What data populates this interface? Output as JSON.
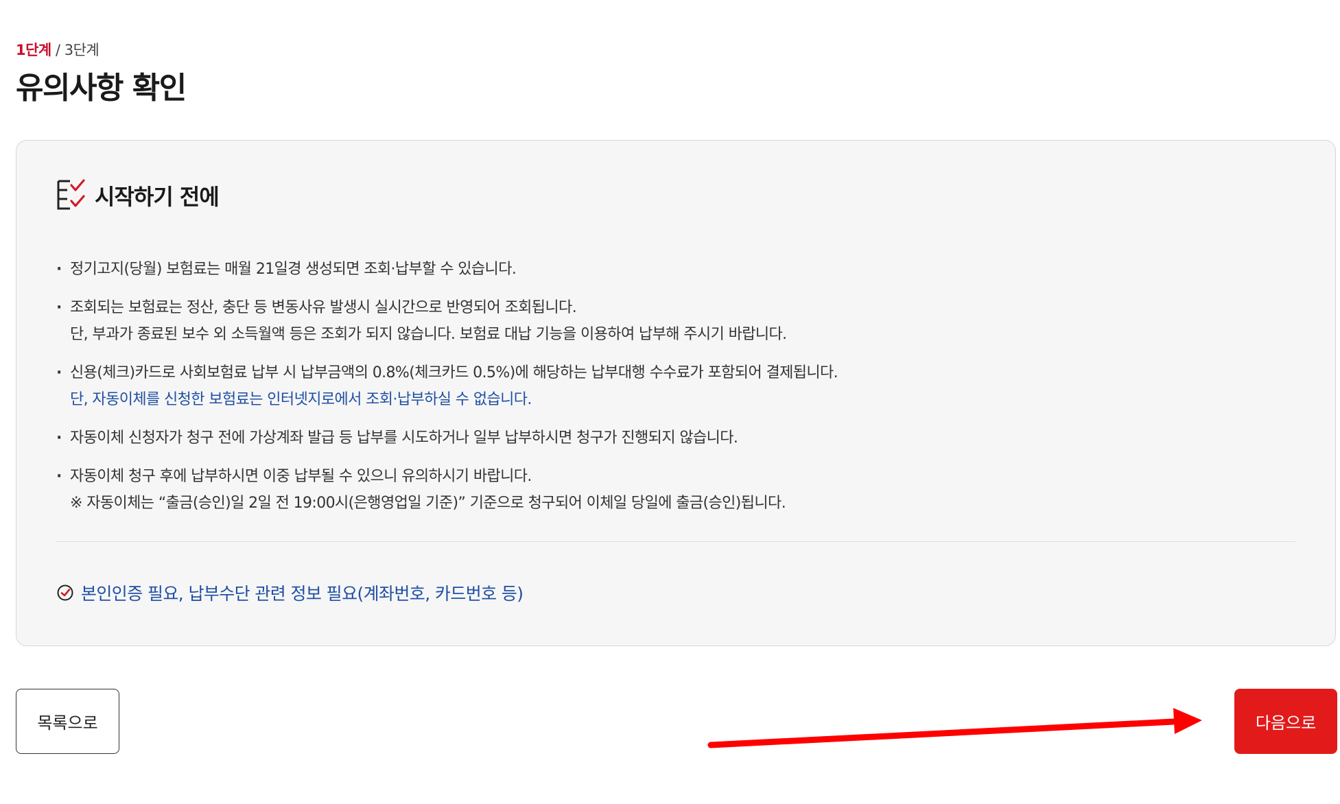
{
  "step": {
    "current": "1단계",
    "separator": " / ",
    "total": "3단계"
  },
  "page": {
    "title": "유의사항 확인"
  },
  "panel": {
    "title": "시작하기 전에",
    "title_icon": "checklist-icon",
    "notices": [
      {
        "lines": [
          "정기고지(당월) 보험료는 매월 21일경 생성되면 조회·납부할 수 있습니다."
        ]
      },
      {
        "lines": [
          "조회되는 보험료는 정산, 충단 등 변동사유 발생시 실시간으로 반영되어 조회됩니다.",
          "단, 부과가 종료된 보수 외 소득월액 등은 조회가 되지 않습니다. 보험료 대납 기능을 이용하여 납부해 주시기 바랍니다."
        ]
      },
      {
        "lines": [
          "신용(체크)카드로 사회보험료 납부 시 납부금액의 0.8%(체크카드 0.5%)에 해당하는 납부대행 수수료가 포함되어 결제됩니다.",
          "단, 자동이체를 신청한 보험료는 인터넷지로에서 조회·납부하실 수 없습니다."
        ]
      },
      {
        "lines": [
          "자동이체 신청자가 청구 전에 가상계좌 발급 등 납부를 시도하거나 일부 납부하시면 청구가 진행되지 않습니다."
        ]
      },
      {
        "lines": [
          "자동이체 청구 후에 납부하시면 이중 납부될 수 있으니 유의하시기 바랍니다.",
          "※ 자동이체는 “출금(승인)일 2일 전 19:00시(은행영업일 기준)” 기준으로 청구되어 이체일 당일에 출금(승인)됩니다."
        ]
      }
    ],
    "requirement": {
      "icon": "check-circle-icon",
      "text": "본인인증 필요, 납부수단 관련 정보 필요(계좌번호, 카드번호 등)"
    }
  },
  "buttons": {
    "list": "목록으로",
    "next": "다음으로"
  },
  "annotation": {
    "icon": "red-arrow-icon"
  },
  "colors": {
    "accent": "#c8102e",
    "next_button": "#e31a1a",
    "link_blue": "#1f4fa3",
    "arrow": "#ff0000"
  }
}
